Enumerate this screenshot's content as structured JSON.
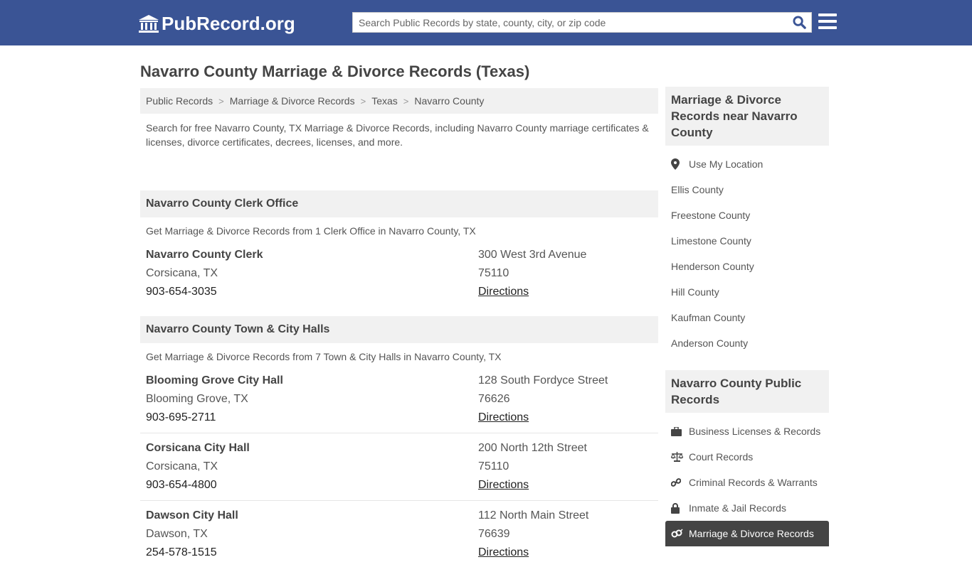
{
  "header": {
    "logo_text": "PubRecord.org",
    "search_placeholder": "Search Public Records by state, county, city, or zip code",
    "colors": {
      "brand": "#3a5495"
    }
  },
  "page_title": "Navarro County Marriage & Divorce Records (Texas)",
  "breadcrumb": [
    "Public Records",
    "Marriage & Divorce Records",
    "Texas",
    "Navarro County"
  ],
  "intro": "Search for free Navarro County, TX Marriage & Divorce Records, including Navarro County marriage certificates & licenses, divorce certificates, decrees, licenses, and more.",
  "sections": [
    {
      "title": "Navarro County Clerk Office",
      "subtitle": "Get Marriage & Divorce Records from 1 Clerk Office in Navarro County, TX",
      "entries": [
        {
          "name": "Navarro County Clerk",
          "city": "Corsicana, TX",
          "phone": "903-654-3035",
          "address": "300 West 3rd Avenue",
          "zip": "75110",
          "link": "Directions"
        }
      ]
    },
    {
      "title": "Navarro County Town & City Halls",
      "subtitle": "Get Marriage & Divorce Records from 7 Town & City Halls in Navarro County, TX",
      "entries": [
        {
          "name": "Blooming Grove City Hall",
          "city": "Blooming Grove, TX",
          "phone": "903-695-2711",
          "address": "128 South Fordyce Street",
          "zip": "76626",
          "link": "Directions"
        },
        {
          "name": "Corsicana City Hall",
          "city": "Corsicana, TX",
          "phone": "903-654-4800",
          "address": "200 North 12th Street",
          "zip": "75110",
          "link": "Directions"
        },
        {
          "name": "Dawson City Hall",
          "city": "Dawson, TX",
          "phone": "254-578-1515",
          "address": "112 North Main Street",
          "zip": "76639",
          "link": "Directions"
        }
      ]
    }
  ],
  "sidebar": {
    "nearby_title": "Marriage & Divorce Records near Navarro County",
    "use_location": "Use My Location",
    "nearby": [
      "Ellis County",
      "Freestone County",
      "Limestone County",
      "Henderson County",
      "Hill County",
      "Kaufman County",
      "Anderson County"
    ],
    "public_title": "Navarro County Public Records",
    "public_items": [
      {
        "label": "Business Licenses & Records",
        "icon": "briefcase-icon"
      },
      {
        "label": "Court Records",
        "icon": "scales-icon"
      },
      {
        "label": "Criminal Records & Warrants",
        "icon": "link-icon"
      },
      {
        "label": "Inmate & Jail Records",
        "icon": "lock-icon"
      },
      {
        "label": "Marriage & Divorce Records",
        "icon": "rings-icon",
        "active": true
      }
    ]
  }
}
